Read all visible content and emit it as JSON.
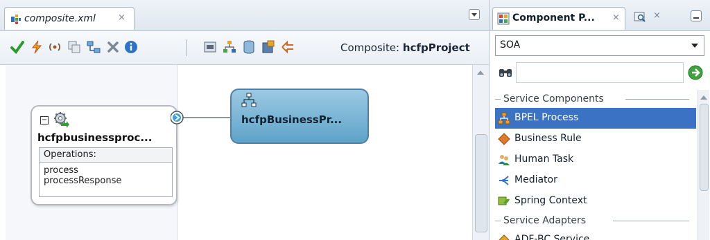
{
  "editor": {
    "tab": {
      "title": "composite.xml",
      "close": "×"
    },
    "toolbar": {
      "icons": [
        "validate-check-icon",
        "deploy-lightning-icon",
        "wsdl-service-icon",
        "copy-icon",
        "layout-icon",
        "delete-icon",
        "info-icon",
        "test-icon",
        "tree-icon",
        "db-icon",
        "graph-icon",
        "orchestration-icon"
      ],
      "composite_label": "Composite:",
      "composite_name": "hcfpProject"
    },
    "service": {
      "name": "hcfpbusinessproc...",
      "operations_header": "Operations:",
      "operations": [
        "process",
        "processResponse"
      ]
    },
    "bpel": {
      "name": "hcfpBusinessPr..."
    }
  },
  "palette": {
    "tab1": {
      "title": "Component P...",
      "close": "×"
    },
    "tab2": {
      "close": "×"
    },
    "select": {
      "value": "SOA"
    },
    "search": {
      "placeholder": ""
    },
    "sections": [
      {
        "title": "Service Components",
        "items": [
          {
            "label": "BPEL Process",
            "icon": "bpel-process-icon",
            "selected": true
          },
          {
            "label": "Business Rule",
            "icon": "business-rule-icon"
          },
          {
            "label": "Human Task",
            "icon": "human-task-icon"
          },
          {
            "label": "Mediator",
            "icon": "mediator-icon"
          },
          {
            "label": "Spring Context",
            "icon": "spring-context-icon"
          }
        ]
      },
      {
        "title": "Service Adapters",
        "items": [
          {
            "label": "ADF-BC Service",
            "icon": "adf-bc-service-icon"
          }
        ]
      }
    ]
  },
  "colors": {
    "selection": "#3c72c4",
    "bpel_fill": "#7fb6d8",
    "accent_check": "#2e9a2e"
  }
}
